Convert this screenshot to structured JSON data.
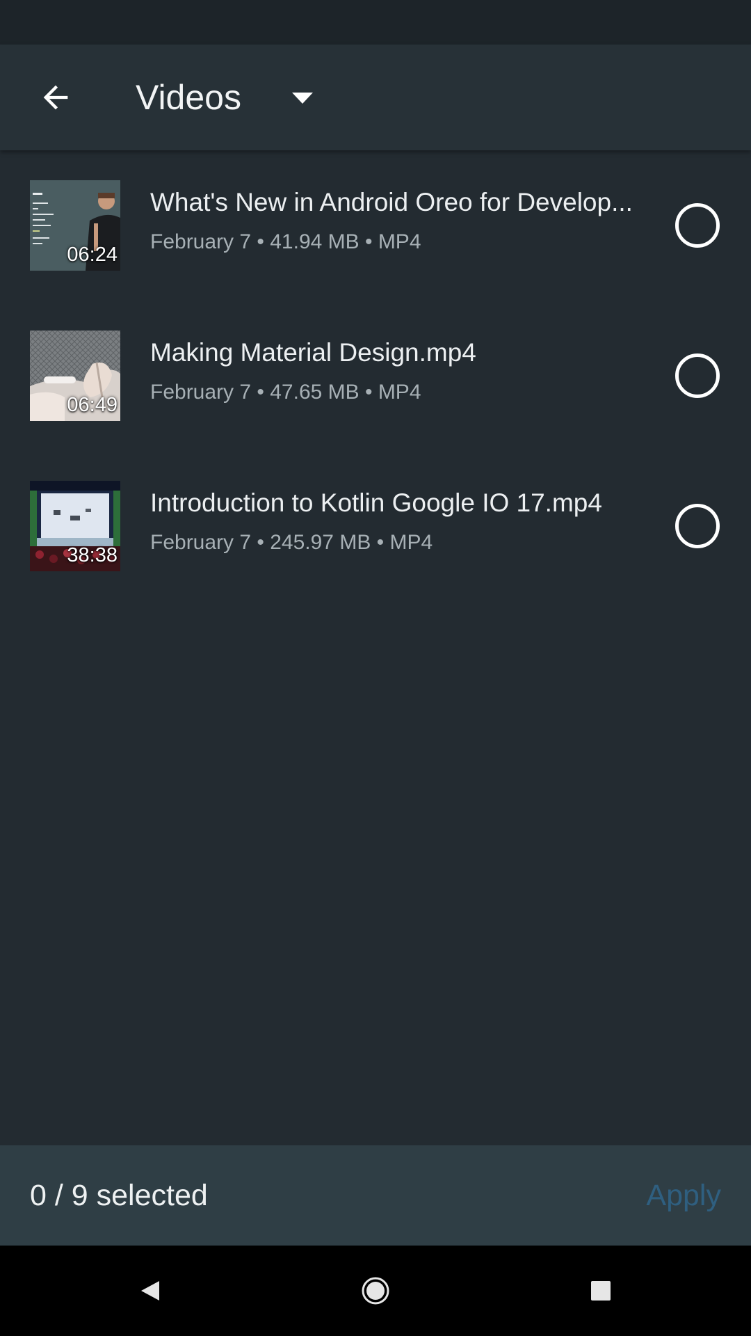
{
  "app_bar": {
    "title": "Videos",
    "back_icon": "arrow-back-icon",
    "dropdown_icon": "arrow-drop-down-icon"
  },
  "files": [
    {
      "name": "What's New in Android Oreo for Develop...",
      "meta": "February 7 • 41.94 MB • MP4",
      "duration": "06:24",
      "selected": false
    },
    {
      "name": "Making Material Design.mp4",
      "meta": "February 7 • 47.65 MB • MP4",
      "duration": "06:49",
      "selected": false
    },
    {
      "name": "Introduction to Kotlin Google IO 17.mp4",
      "meta": "February 7 • 245.97 MB • MP4",
      "duration": "38:38",
      "selected": false
    }
  ],
  "bottom_bar": {
    "selected_count": "0 / 9 selected",
    "apply_label": "Apply"
  },
  "colors": {
    "background": "#232b31",
    "app_bar": "#273137",
    "bottom_bar": "#2f3e45",
    "apply_disabled": "#2f5f80"
  }
}
